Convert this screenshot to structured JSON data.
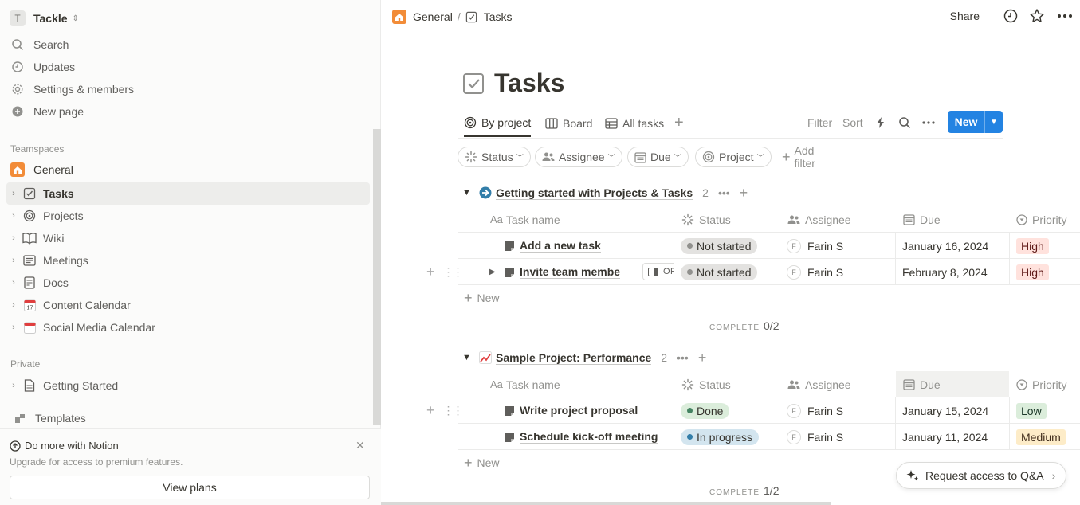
{
  "workspace": {
    "initial": "T",
    "name": "Tackle"
  },
  "sidebar": {
    "nav": [
      {
        "label": "Search",
        "icon": "search-icon"
      },
      {
        "label": "Updates",
        "icon": "clock-icon"
      },
      {
        "label": "Settings & members",
        "icon": "gear-icon"
      },
      {
        "label": "New page",
        "icon": "plus-circle-icon"
      }
    ],
    "teamspaces_label": "Teamspaces",
    "teamspace_name": "General",
    "tree": [
      {
        "label": "Tasks",
        "icon": "checkbox-icon"
      },
      {
        "label": "Projects",
        "icon": "target-icon"
      },
      {
        "label": "Wiki",
        "icon": "book-icon"
      },
      {
        "label": "Meetings",
        "icon": "notes-icon"
      },
      {
        "label": "Docs",
        "icon": "doc-icon"
      },
      {
        "label": "Content Calendar",
        "icon": "calendar-icon"
      },
      {
        "label": "Social Media Calendar",
        "icon": "calendar-icon"
      }
    ],
    "private_label": "Private",
    "private_items": [
      {
        "label": "Getting Started",
        "icon": "page-icon"
      }
    ],
    "templates_label": "Templates",
    "promo": {
      "title": "Do more with Notion",
      "subtitle": "Upgrade for access to premium features.",
      "button": "View plans"
    }
  },
  "topbar": {
    "breadcrumb": [
      "General",
      "Tasks"
    ],
    "share_label": "Share"
  },
  "page": {
    "title": "Tasks",
    "views": [
      {
        "label": "By project",
        "active": true
      },
      {
        "label": "Board",
        "active": false
      },
      {
        "label": "All tasks",
        "active": false
      }
    ],
    "toolbar": {
      "filter": "Filter",
      "sort": "Sort",
      "new": "New"
    },
    "filters": [
      "Status",
      "Assignee",
      "Due",
      "Project"
    ],
    "add_filter": "Add filter",
    "columns": [
      "Task name",
      "Status",
      "Assignee",
      "Due",
      "Priority"
    ],
    "groups": [
      {
        "title": "Getting started with Projects & Tasks",
        "count": "2",
        "rows": [
          {
            "name": "Add a new task",
            "status": "Not started",
            "assignee_initial": "F",
            "assignee": "Farin S",
            "due": "January 16, 2024",
            "priority": "High"
          },
          {
            "name": "Invite team membe",
            "status": "Not started",
            "assignee_initial": "F",
            "assignee": "Farin S",
            "due": "February 8, 2024",
            "priority": "High"
          }
        ],
        "new_label": "New",
        "complete_label": "COMPLETE",
        "complete_value": "0/2"
      },
      {
        "title": "Sample Project: Performance",
        "count": "2",
        "rows": [
          {
            "name": "Write project proposal",
            "status": "Done",
            "assignee_initial": "F",
            "assignee": "Farin S",
            "due": "January 15, 2024",
            "priority": "Low"
          },
          {
            "name": "Schedule kick-off meeting",
            "status": "In progress",
            "assignee_initial": "F",
            "assignee": "Farin S",
            "due": "January 11, 2024",
            "priority": "Medium"
          }
        ],
        "new_label": "New",
        "complete_label": "COMPLETE",
        "complete_value": "1/2"
      }
    ],
    "open_label": "OPEN",
    "qa_button": "Request access to Q&A"
  },
  "colors": {
    "accent": "#2383e2",
    "not_started_bg": "#e3e2e0",
    "done_bg": "#dbeddb",
    "in_progress_bg": "#d3e5ef",
    "high_bg": "#ffe2dd",
    "low_bg": "#dbeddb",
    "medium_bg": "#fdecc8"
  }
}
